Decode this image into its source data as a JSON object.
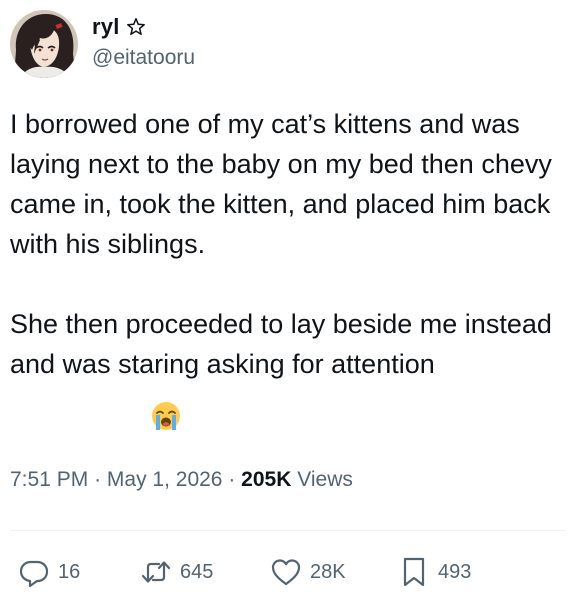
{
  "author": {
    "display_name": "ryl",
    "handle": "@eitatooru",
    "badge_icon": "star-icon"
  },
  "tweet": {
    "paragraphs": [
      "I borrowed one of my cat’s kittens and was laying next to the baby on my bed then chevy came in, took the kitten, and placed him back with his siblings.",
      "She then proceeded to lay beside me instead and was staring asking for attention"
    ],
    "trailing_emoji": "loudly-crying-face-emoji"
  },
  "meta": {
    "time": "7:51 PM",
    "separator": "·",
    "date": "May 1, 2026",
    "views_count": "205K",
    "views_label": "Views"
  },
  "actions": {
    "replies": "16",
    "reposts": "645",
    "likes": "28K",
    "bookmarks": "493"
  },
  "colors": {
    "text": "#0f1419",
    "secondary": "#536471",
    "divider": "#eff3f4"
  }
}
